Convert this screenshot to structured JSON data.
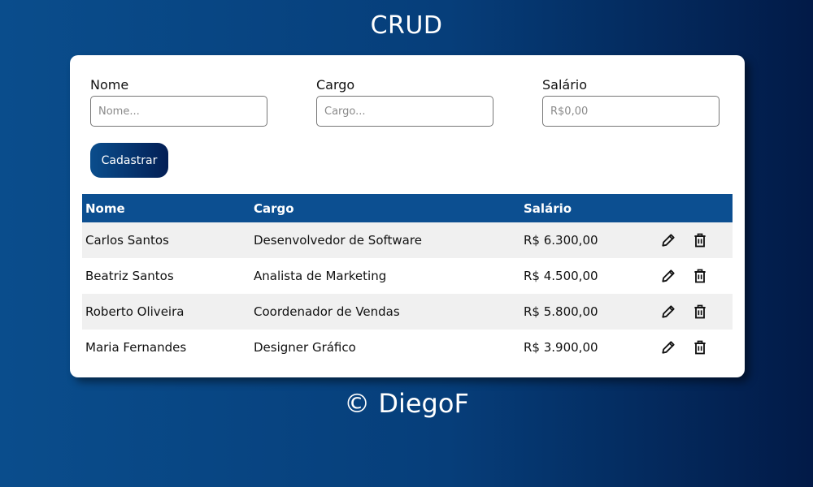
{
  "header": {
    "title": "CRUD"
  },
  "form": {
    "nome": {
      "label": "Nome",
      "placeholder": "Nome...",
      "value": ""
    },
    "cargo": {
      "label": "Cargo",
      "placeholder": "Cargo...",
      "value": ""
    },
    "salario": {
      "label": "Salário",
      "placeholder": "R$0,00",
      "value": ""
    },
    "submit_label": "Cadastrar"
  },
  "table": {
    "columns": [
      "Nome",
      "Cargo",
      "Salário"
    ],
    "rows": [
      {
        "nome": "Carlos Santos",
        "cargo": "Desenvolvedor de Software",
        "salario": "R$ 6.300,00"
      },
      {
        "nome": "Beatriz Santos",
        "cargo": "Analista de Marketing",
        "salario": "R$ 4.500,00"
      },
      {
        "nome": "Roberto Oliveira",
        "cargo": "Coordenador de Vendas",
        "salario": "R$ 5.800,00"
      },
      {
        "nome": "Maria Fernandes",
        "cargo": "Designer Gráfico",
        "salario": "R$ 3.900,00"
      }
    ],
    "row_actions": {
      "edit_icon": "pencil-icon",
      "delete_icon": "trash-icon"
    }
  },
  "footer": {
    "text": "© DiegoF"
  },
  "colors": {
    "background_start": "#0a4d8c",
    "background_end": "#021a47",
    "table_header": "#0c4f91",
    "row_alt": "#f0f0f0"
  }
}
